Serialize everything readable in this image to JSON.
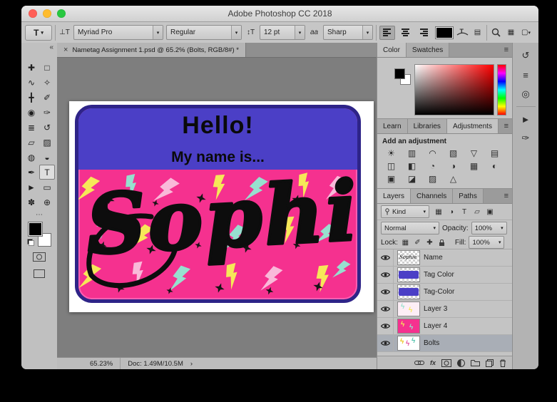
{
  "window": {
    "title": "Adobe Photoshop CC 2018"
  },
  "options_bar": {
    "tool_preset": "T",
    "orientation_icon": "⊥T",
    "font_family": "Myriad Pro",
    "font_style": "Regular",
    "size_icon": "↕T",
    "font_size": "12 pt",
    "aa_icon": "aa",
    "anti_alias": "Sharp"
  },
  "doc_tab": {
    "close": "×",
    "title": "Nametag Assignment 1.psd @ 65.2% (Bolts, RGB/8#) *"
  },
  "canvas": {
    "hello": "Hello!",
    "subtitle": "My name is...",
    "name": "Sophie",
    "tag_colors": {
      "border": "#2e2488",
      "band": "#4b3fc6",
      "background": "#f5318f",
      "inner_line": "#ff5fb2"
    },
    "bolt_colors": [
      "#f6e858",
      "#97e0cf",
      "#f9b9d9",
      "#ffffff"
    ]
  },
  "toolbar": {
    "collapse": "«",
    "more": "⋯",
    "tools": [
      {
        "name": "move-tool",
        "glyph": "✚"
      },
      {
        "name": "marquee-tool",
        "glyph": "□"
      },
      {
        "name": "lasso-tool",
        "glyph": "∿"
      },
      {
        "name": "quick-selection-tool",
        "glyph": "✧"
      },
      {
        "name": "crop-tool",
        "glyph": "╋"
      },
      {
        "name": "eyedropper-tool",
        "glyph": "✐"
      },
      {
        "name": "healing-brush-tool",
        "glyph": "◉"
      },
      {
        "name": "brush-tool",
        "glyph": "✑"
      },
      {
        "name": "clone-stamp-tool",
        "glyph": "≣"
      },
      {
        "name": "history-brush-tool",
        "glyph": "↺"
      },
      {
        "name": "eraser-tool",
        "glyph": "▱"
      },
      {
        "name": "gradient-tool",
        "glyph": "▨"
      },
      {
        "name": "blur-tool",
        "glyph": "◍"
      },
      {
        "name": "dodge-tool",
        "glyph": "◒"
      },
      {
        "name": "pen-tool",
        "glyph": "✒"
      },
      {
        "name": "type-tool",
        "glyph": "T",
        "selected": true
      },
      {
        "name": "path-selection-tool",
        "glyph": "►"
      },
      {
        "name": "shape-tool",
        "glyph": "▭"
      },
      {
        "name": "hand-tool",
        "glyph": "✽"
      },
      {
        "name": "zoom-tool",
        "glyph": "⊕"
      }
    ]
  },
  "panels": {
    "color": {
      "tabs": [
        "Color",
        "Swatches"
      ]
    },
    "adjustments": {
      "tabs": [
        "Learn",
        "Libraries",
        "Adjustments"
      ],
      "label": "Add an adjustment",
      "items": [
        {
          "name": "brightness-contrast-adjustment",
          "glyph": "☀"
        },
        {
          "name": "levels-adjustment",
          "glyph": "▥"
        },
        {
          "name": "curves-adjustment",
          "glyph": "◠"
        },
        {
          "name": "exposure-adjustment",
          "glyph": "▧"
        },
        {
          "name": "vibrance-adjustment",
          "glyph": "▽"
        },
        {
          "name": "hue-saturation-adjustment",
          "glyph": "▤"
        },
        {
          "name": "color-balance-adjustment",
          "glyph": "◫"
        },
        {
          "name": "black-white-adjustment",
          "glyph": "◧"
        },
        {
          "name": "photo-filter-adjustment",
          "glyph": "◔"
        },
        {
          "name": "channel-mixer-adjustment",
          "glyph": "◑"
        },
        {
          "name": "color-lookup-adjustment",
          "glyph": "▦"
        },
        {
          "name": "invert-adjustment",
          "glyph": "◐"
        },
        {
          "name": "posterize-adjustment",
          "glyph": "▣"
        },
        {
          "name": "threshold-adjustment",
          "glyph": "◪"
        },
        {
          "name": "gradient-map-adjustment",
          "glyph": "▨"
        },
        {
          "name": "selective-color-adjustment",
          "glyph": "△"
        }
      ]
    },
    "layers": {
      "tabs": [
        "Layers",
        "Channels",
        "Paths"
      ],
      "filter_label": "Kind",
      "filter_icons": [
        {
          "name": "pixel-layer-filter-icon",
          "glyph": "▦"
        },
        {
          "name": "adjustment-layer-filter-icon",
          "glyph": "◑"
        },
        {
          "name": "type-layer-filter-icon",
          "glyph": "T"
        },
        {
          "name": "shape-layer-filter-icon",
          "glyph": "▱"
        },
        {
          "name": "smart-object-filter-icon",
          "glyph": "▣"
        }
      ],
      "blend_mode": "Normal",
      "opacity_label": "Opacity:",
      "opacity": "100%",
      "lock_label": "Lock:",
      "lock_icons": [
        {
          "name": "lock-transparency-icon",
          "glyph": "▦"
        },
        {
          "name": "lock-pixels-icon",
          "glyph": "✐"
        },
        {
          "name": "lock-position-icon",
          "glyph": "✚"
        },
        {
          "name": "lock-all-icon",
          "glyph": "lock"
        }
      ],
      "fill_label": "Fill:",
      "fill": "100%",
      "items": [
        {
          "name": "Name",
          "thumb": "name"
        },
        {
          "name": "Tag Color",
          "thumb": "tag"
        },
        {
          "name": "Tag-Color",
          "thumb": "tag"
        },
        {
          "name": "Layer 3",
          "thumb": "pattern-light"
        },
        {
          "name": "Layer 4",
          "thumb": "pattern-pink"
        },
        {
          "name": "Bolts",
          "thumb": "bolts",
          "selected": true
        }
      ],
      "footer_fx": "fx"
    }
  },
  "dock_icons": [
    {
      "name": "history-panel-icon",
      "glyph": "↺"
    },
    {
      "name": "properties-panel-icon",
      "glyph": "≡"
    },
    {
      "name": "info-panel-icon",
      "glyph": "◎"
    },
    {
      "name": "actions-panel-icon",
      "glyph": "►"
    },
    {
      "name": "brushes-panel-icon",
      "glyph": "✑"
    }
  ],
  "status_bar": {
    "zoom": "65.23%",
    "doc": "Doc: 1.49M/10.5M",
    "chevron": "›"
  }
}
